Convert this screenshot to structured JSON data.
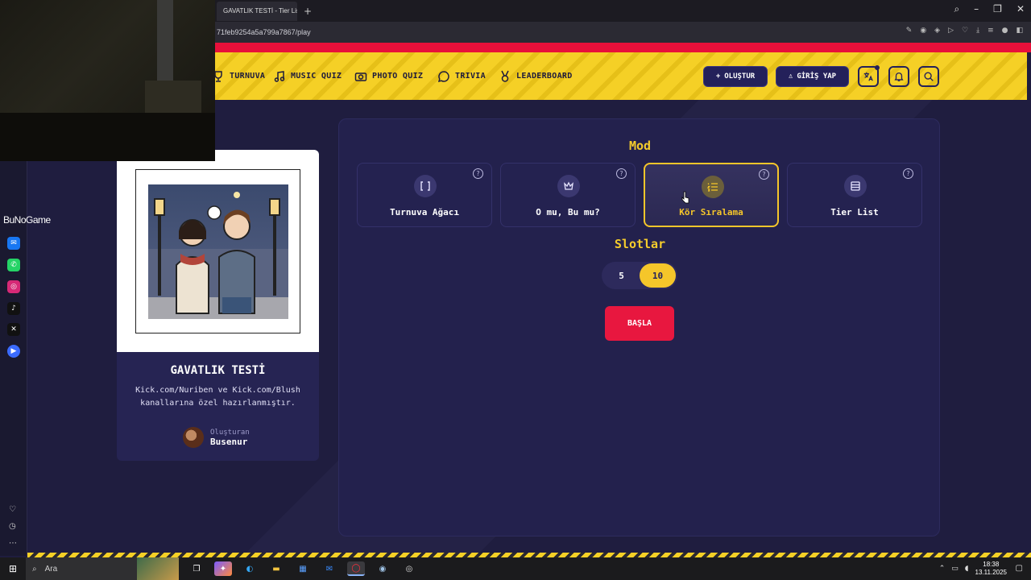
{
  "browser": {
    "tab_title": "GAVATLIK TESTİ - Tier List",
    "url": "71feb9254a5a799a7867/play",
    "new_tab": "+"
  },
  "overlay": {
    "watermark": "BuNoGame"
  },
  "header": {
    "nav": [
      {
        "label": "TURNUVA",
        "icon": "trophy-icon"
      },
      {
        "label": "MUSIC QUIZ",
        "icon": "music-note-icon"
      },
      {
        "label": "PHOTO QUIZ",
        "icon": "camera-icon"
      },
      {
        "label": "TRIVIA",
        "icon": "chat-bubble-icon"
      },
      {
        "label": "LEADERBOARD",
        "icon": "medal-icon"
      }
    ],
    "create_label": "OLUŞTUR",
    "login_label": "GİRİŞ YAP",
    "colors": {
      "stripe": "#f5d026",
      "accent": "#24215a",
      "red": "#e8103a"
    }
  },
  "quiz": {
    "title": "GAVATLIK TESTİ",
    "description": "Kick.com/Nuriben ve Kick.com/Blush kanallarına özel hazırlanmıştır.",
    "creator_label": "Oluşturan",
    "creator_name": "Busenur"
  },
  "mode": {
    "title": "Mod",
    "options": [
      {
        "label": "Turnuva Ağacı",
        "icon": "bracket-icon",
        "selected": false
      },
      {
        "label": "O mu, Bu mu?",
        "icon": "crown-icon",
        "selected": false
      },
      {
        "label": "Kör Sıralama",
        "icon": "numbered-list-icon",
        "selected": true
      },
      {
        "label": "Tier List",
        "icon": "list-icon",
        "selected": false
      }
    ],
    "help": "?"
  },
  "slots": {
    "title": "Slotlar",
    "options": [
      "5",
      "10"
    ],
    "selected": "10"
  },
  "start_label": "BAŞLA",
  "taskbar": {
    "search_placeholder": "Ara",
    "time": "18:38",
    "date": "13.11.2025"
  }
}
